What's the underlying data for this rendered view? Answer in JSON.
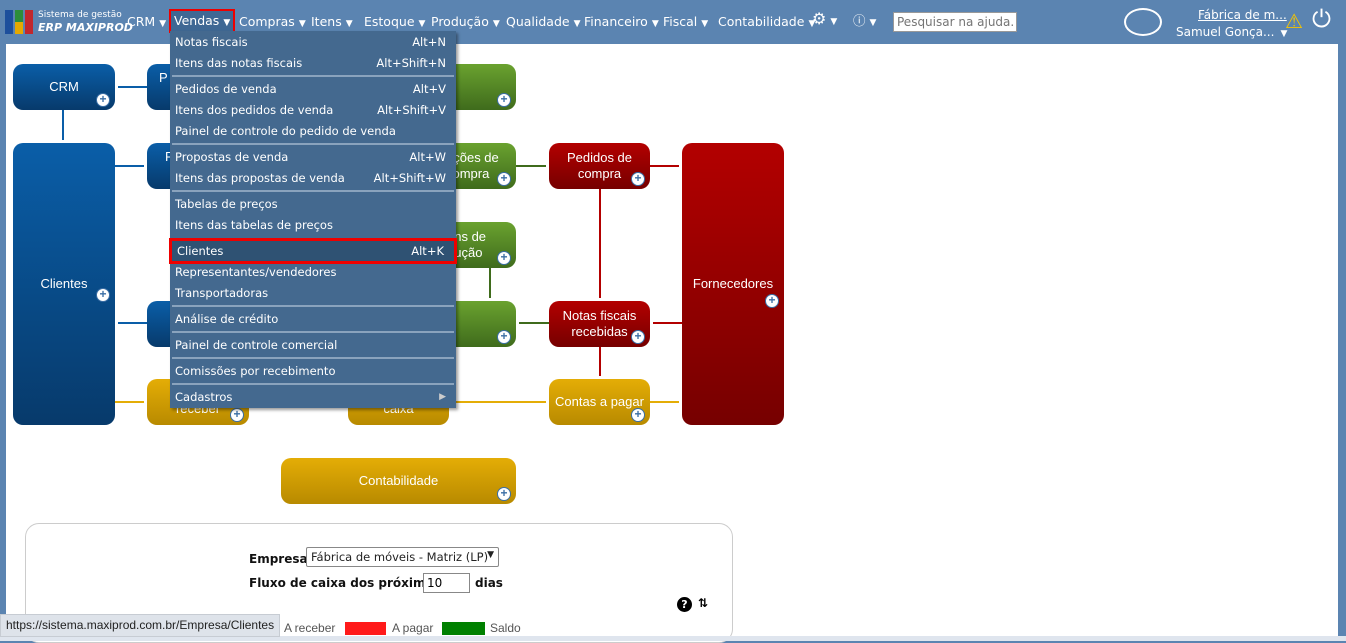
{
  "app": {
    "logo_line1": "Sistema de gestão",
    "logo_line2": "ERP MAXIPROD"
  },
  "nav": {
    "items": [
      "CRM",
      "Vendas",
      "Compras",
      "Itens",
      "Estoque",
      "Produção",
      "Qualidade",
      "Financeiro",
      "Fiscal",
      "Contabilidade"
    ],
    "active": "Vendas",
    "help_placeholder": "Pesquisar na ajuda...",
    "company": "Fábrica de m...",
    "user": "Samuel Gonça..."
  },
  "menu": [
    {
      "label": "Notas fiscais",
      "shortcut": "Alt+N"
    },
    {
      "label": "Itens das notas fiscais",
      "shortcut": "Alt+Shift+N"
    },
    {
      "label": "Pedidos de venda",
      "shortcut": "Alt+V"
    },
    {
      "label": "Itens dos pedidos de venda",
      "shortcut": "Alt+Shift+V"
    },
    {
      "label": "Painel de controle do pedido de venda",
      "shortcut": ""
    },
    {
      "label": "Propostas de venda",
      "shortcut": "Alt+W"
    },
    {
      "label": "Itens das propostas de venda",
      "shortcut": "Alt+Shift+W"
    },
    {
      "label": "Tabelas de preços",
      "shortcut": ""
    },
    {
      "label": "Itens das tabelas de preços",
      "shortcut": ""
    },
    {
      "label": "Clientes",
      "shortcut": "Alt+K"
    },
    {
      "label": "Representantes/vendedores",
      "shortcut": ""
    },
    {
      "label": "Transportadoras",
      "shortcut": ""
    },
    {
      "label": "Análise de crédito",
      "shortcut": ""
    },
    {
      "label": "Painel de controle comercial",
      "shortcut": ""
    },
    {
      "label": "Comissões por recebimento",
      "shortcut": ""
    },
    {
      "label": "Cadastros",
      "shortcut": ""
    }
  ],
  "diagram": {
    "crm": "CRM",
    "clientes": "Clientes",
    "col2_row1": "P",
    "col2_row2": "P",
    "col3_row2": "ações de compra",
    "col3_row3": "ens de dução",
    "col2_row5": "receber",
    "col3_row5": "caixa",
    "pedidos_compra": "Pedidos de compra",
    "notas_recebidas": "Notas fiscais recebidas",
    "contas_pagar": "Contas a pagar",
    "fornecedores": "Fornecedores",
    "contabilidade": "Contabilidade"
  },
  "panel": {
    "empresa_label": "Empresa",
    "empresa_value": "Fábrica de móveis - Matriz (LP)",
    "fluxo_label": "Fluxo de caixa dos próximos",
    "fluxo_value": "10",
    "dias_label": "dias",
    "legend": [
      {
        "label": "A receber",
        "color": "#1f77ff"
      },
      {
        "label": "A pagar",
        "color": "#ff1a1a"
      },
      {
        "label": "Saldo",
        "color": "#008000"
      }
    ]
  },
  "status_url": "https://sistema.maxiprod.com.br/Empresa/Clientes"
}
